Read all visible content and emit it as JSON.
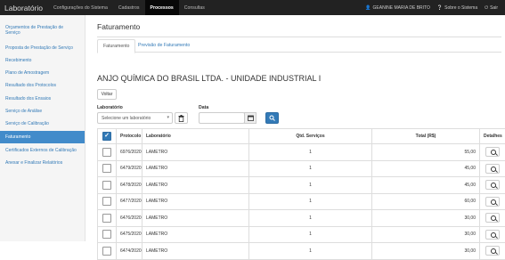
{
  "app": {
    "brand": "Laboratório"
  },
  "topnav": {
    "items": [
      "Configurações do Sistema",
      "Cadastros",
      "Processos",
      "Consultas"
    ],
    "active": "Processos",
    "user": "GEANINE MARIA DE BRITO",
    "about": "Sobre o Sistema",
    "exit": "Sair"
  },
  "sidebar": {
    "items": [
      "Orçamentos de Prestação de Serviço",
      "Proposta de Prestação de Serviço",
      "Recebimento",
      "Plano de Amostragem",
      "Resultado dos Protocolos",
      "Resultado dos Ensaios",
      "Serviço de Análise",
      "Serviço de Calibração",
      "Faturamento",
      "Certificados Externos de Calibração",
      "Anexar e Finalizar Relatórios"
    ],
    "active": "Faturamento"
  },
  "page": {
    "title": "Faturamento",
    "tabs": [
      "Faturamento",
      "Previsão de Faturamento"
    ],
    "company": "ANJO QUÍMICA DO BRASIL LTDA. - UNIDADE INDUSTRIAL I",
    "back_label": "Voltar"
  },
  "filters": {
    "lab_label": "Laboratório",
    "lab_placeholder": "Selecione um laboratório",
    "date_label": "Data",
    "date_value": ""
  },
  "table": {
    "columns": [
      "Protocolo",
      "Laboratório",
      "Qtd. Serviços",
      "Total (R$)",
      "Detalhes"
    ],
    "rows": [
      {
        "protocolo": "6976/2020",
        "laboratorio": "LAMETRO",
        "qtd": "1",
        "total": "55,00"
      },
      {
        "protocolo": "6479/2020",
        "laboratorio": "LAMETRO",
        "qtd": "1",
        "total": "45,00"
      },
      {
        "protocolo": "6478/2020",
        "laboratorio": "LAMETRO",
        "qtd": "1",
        "total": "45,00"
      },
      {
        "protocolo": "6477/2020",
        "laboratorio": "LAMETRO",
        "qtd": "1",
        "total": "60,00"
      },
      {
        "protocolo": "6476/2020",
        "laboratorio": "LAMETRO",
        "qtd": "1",
        "total": "30,00"
      },
      {
        "protocolo": "6475/2020",
        "laboratorio": "LAMETRO",
        "qtd": "1",
        "total": "30,00"
      },
      {
        "protocolo": "6474/2020",
        "laboratorio": "LAMETRO",
        "qtd": "1",
        "total": "30,00"
      }
    ]
  },
  "colors": {
    "topbar": "#222222",
    "primary": "#337ab7",
    "sidebar_active": "#428bca"
  },
  "icons": [
    "user-icon",
    "question-circle-icon",
    "power-icon",
    "trash-icon",
    "calendar-icon",
    "search-icon",
    "check-icon"
  ]
}
